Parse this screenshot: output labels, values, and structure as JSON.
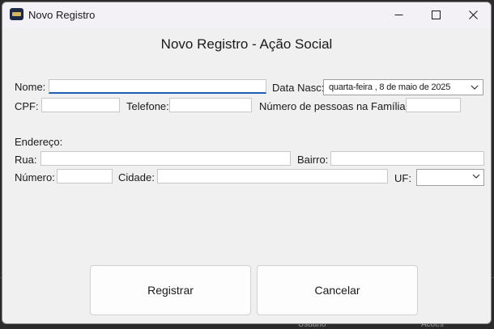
{
  "background": {
    "text_a": "Usuario",
    "text_b": "Acoes"
  },
  "window": {
    "title": "Novo Registro",
    "icon": "app-icon"
  },
  "form": {
    "heading": "Novo Registro - Ação Social",
    "nome_label": "Nome:",
    "nome_value": "",
    "data_nasc_label": "Data Nasc:",
    "data_nasc_value": "quarta-feira ,   8 de     maio     de 2025",
    "cpf_label": "CPF:",
    "cpf_value": "",
    "telefone_label": "Telefone:",
    "telefone_value": "",
    "pessoas_label": "Número de pessoas na Família:",
    "pessoas_value": "",
    "endereco_label": "Endereço:",
    "rua_label": "Rua:",
    "rua_value": "",
    "bairro_label": "Bairro:",
    "bairro_value": "",
    "numero_label": "Número:",
    "numero_value": "",
    "cidade_label": "Cidade:",
    "cidade_value": "",
    "uf_label": "UF:",
    "uf_value": ""
  },
  "buttons": {
    "register": "Registrar",
    "cancel": "Cancelar"
  },
  "colors": {
    "focus_underline": "#1a5fb4",
    "window_bg": "#f0f0f0",
    "titlebar_bg": "#f3f0f6"
  }
}
